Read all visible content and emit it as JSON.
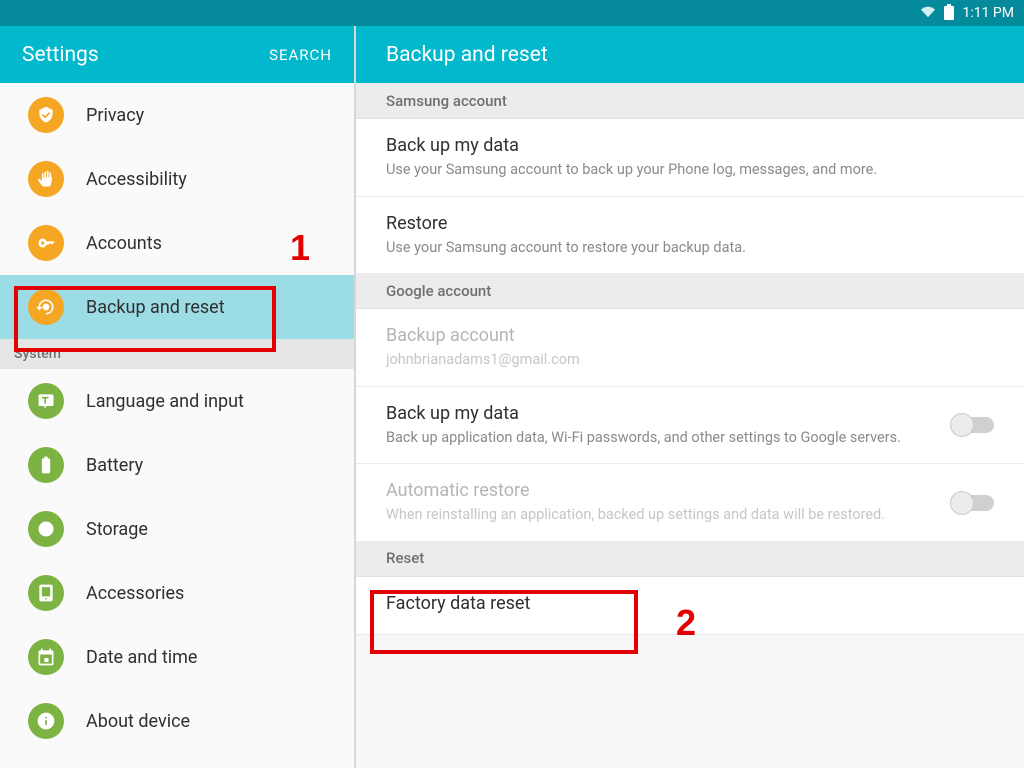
{
  "status": {
    "time": "1:11 PM"
  },
  "sidebar": {
    "title": "Settings",
    "search": "SEARCH",
    "items": {
      "privacy": {
        "label": "Privacy",
        "color": "orange",
        "icon": "privacy"
      },
      "accessibility": {
        "label": "Accessibility",
        "color": "orange",
        "icon": "hand"
      },
      "accounts": {
        "label": "Accounts",
        "color": "orange",
        "icon": "key"
      },
      "backup": {
        "label": "Backup and reset",
        "color": "orange",
        "icon": "backup",
        "selected": true
      },
      "language": {
        "label": "Language and input",
        "color": "green",
        "icon": "language"
      },
      "battery": {
        "label": "Battery",
        "color": "green",
        "icon": "battery"
      },
      "storage": {
        "label": "Storage",
        "color": "green",
        "icon": "storage"
      },
      "accessories": {
        "label": "Accessories",
        "color": "green",
        "icon": "tablet"
      },
      "datetime": {
        "label": "Date and time",
        "color": "green",
        "icon": "calendar"
      },
      "about": {
        "label": "About device",
        "color": "green",
        "icon": "info"
      }
    },
    "section_system": "System"
  },
  "detail": {
    "title": "Backup and reset",
    "sections": {
      "samsung": {
        "header": "Samsung account",
        "items": {
          "backup_my_data": {
            "title": "Back up my data",
            "sub": "Use your Samsung account to back up your Phone log, messages, and more."
          },
          "restore": {
            "title": "Restore",
            "sub": "Use your Samsung account to restore your backup data."
          }
        }
      },
      "google": {
        "header": "Google account",
        "items": {
          "backup_account": {
            "title": "Backup account",
            "sub": "johnbrianadams1@gmail.com"
          },
          "backup_my_data": {
            "title": "Back up my data",
            "sub": "Back up application data, Wi-Fi passwords, and other settings to Google servers.",
            "toggle": false
          },
          "auto_restore": {
            "title": "Automatic restore",
            "sub": "When reinstalling an application, backed up settings and data will be restored.",
            "toggle": false,
            "disabled": true
          }
        }
      },
      "reset": {
        "header": "Reset",
        "items": {
          "factory": {
            "title": "Factory data reset"
          }
        }
      }
    }
  },
  "annotations": {
    "n1": "1",
    "n2": "2"
  }
}
